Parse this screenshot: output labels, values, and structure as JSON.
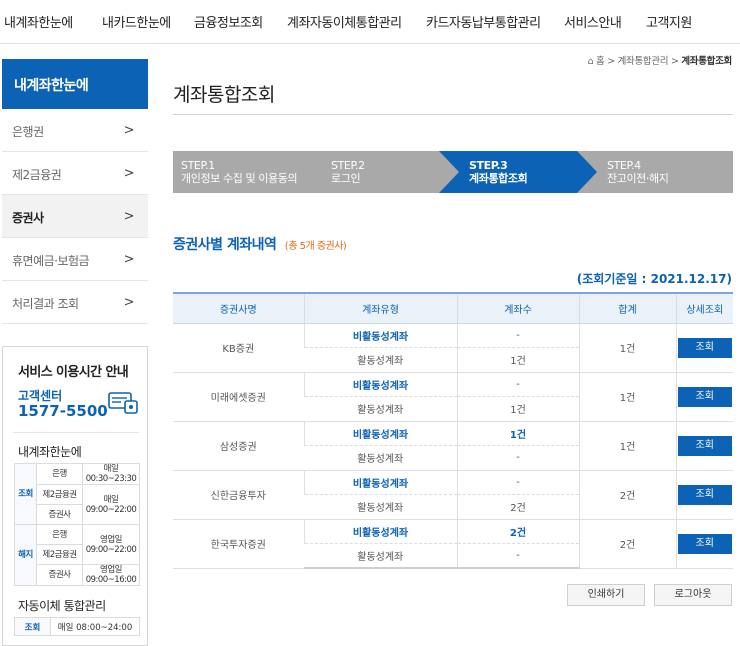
{
  "topnav": [
    "내계좌한눈에",
    "내카드한눈에",
    "금융정보조회",
    "계좌자동이체통합관리",
    "카드자동납부통합관리",
    "서비스안내",
    "고객지원"
  ],
  "sidebar": {
    "title": "내계좌한눈에",
    "items": [
      {
        "label": "은행권"
      },
      {
        "label": "제2금융권"
      },
      {
        "label": "증권사"
      },
      {
        "label": "휴면예금·보험금"
      },
      {
        "label": "처리결과 조회"
      }
    ]
  },
  "service": {
    "title": "서비스 이용시간 안내",
    "cc_label": "고객센터",
    "phone": "1577-5500",
    "sub1": "내계좌한눈에",
    "rows": [
      {
        "group": "조회",
        "org": "은행",
        "time": "매일 00:30~23:30"
      },
      {
        "org": "제2금융권",
        "time": "매일 09:00~22:00"
      },
      {
        "org": "증권사"
      },
      {
        "group": "해지",
        "org": "은행",
        "time": "영업일 09:00~22:00"
      },
      {
        "org": "제2금융권"
      },
      {
        "org": "증권사",
        "time": "영업일 09:00~16:00"
      }
    ],
    "sub2": "자동이체 통합관리",
    "auto_group": "조회",
    "auto_time": "매일 08:00~24:00"
  },
  "breadcrumb": {
    "home": "홈",
    "b1": "계좌통합관리",
    "b2": "계좌통합조회"
  },
  "page_title": "계좌통합조회",
  "steps": [
    {
      "num": "STEP.1",
      "label": "개인정보 수집 및 이용동의"
    },
    {
      "num": "STEP.2",
      "label": "로그인"
    },
    {
      "num": "STEP.3",
      "label": "계좌통합조회"
    },
    {
      "num": "STEP.4",
      "label": "잔고이전·해지"
    }
  ],
  "section": {
    "title": "증권사별 계좌내역",
    "count": "(총 5개 증권사)"
  },
  "as_of": "(조회기준일 : 2021.12.17)",
  "table": {
    "headers": [
      "증권사명",
      "계좌유형",
      "계좌수",
      "합계",
      "상세조회"
    ],
    "rows": [
      {
        "company": "KB증권",
        "inactive_label": "비활동성계좌",
        "inactive_count": "-",
        "active_label": "활동성계좌",
        "active_count": "1건",
        "total": "1건",
        "btn": "조회"
      },
      {
        "company": "미래에셋증권",
        "inactive_label": "비활동성계좌",
        "inactive_count": "-",
        "active_label": "활동성계좌",
        "active_count": "1건",
        "total": "1건",
        "btn": "조회"
      },
      {
        "company": "삼성증권",
        "inactive_label": "비활동성계좌",
        "inactive_count": "1건",
        "active_label": "활동성계좌",
        "active_count": "-",
        "total": "1건",
        "btn": "조회"
      },
      {
        "company": "신한금융투자",
        "inactive_label": "비활동성계좌",
        "inactive_count": "-",
        "active_label": "활동성계좌",
        "active_count": "2건",
        "total": "2건",
        "btn": "조회"
      },
      {
        "company": "한국투자증권",
        "inactive_label": "비활동성계좌",
        "inactive_count": "2건",
        "active_label": "활동성계좌",
        "active_count": "-",
        "total": "2건",
        "btn": "조회"
      }
    ]
  },
  "buttons": {
    "print": "인쇄하기",
    "logout": "로그아웃"
  },
  "colors": {
    "primary": "#0c62b4",
    "step_inactive": "#a9a9a9",
    "count_note": "#e06b17"
  }
}
